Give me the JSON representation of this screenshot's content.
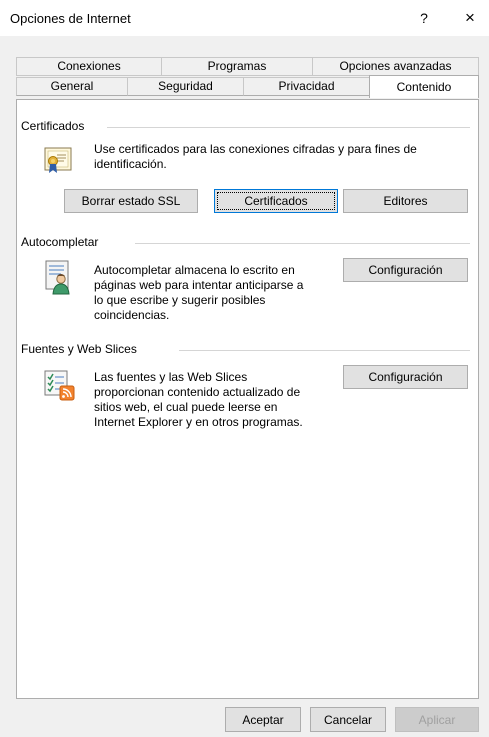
{
  "window": {
    "title": "Opciones de Internet",
    "help": "?",
    "close": "×"
  },
  "tabs_row1": [
    "Conexiones",
    "Programas",
    "Opciones avanzadas"
  ],
  "tabs_row2": [
    "General",
    "Seguridad",
    "Privacidad",
    "Contenido"
  ],
  "active_tab": "Contenido",
  "certificates": {
    "header": "Certificados",
    "line1": "Use certificados para las conexiones cifradas y para fines de",
    "line2": "identificación.",
    "btn_ssl": "Borrar estado SSL",
    "btn_certs": "Certificados",
    "btn_publishers": "Editores"
  },
  "autocomplete": {
    "header": "Autocompletar",
    "lines": [
      "Autocompletar almacena lo escrito en",
      "páginas web para intentar anticiparse a",
      "lo que escribe y sugerir posibles",
      "coincidencias."
    ],
    "btn": "Configuración"
  },
  "feeds": {
    "header": "Fuentes y Web Slices",
    "lines": [
      "Las fuentes y las Web Slices",
      "proporcionan contenido actualizado de",
      "sitios web, el cual puede leerse en",
      "Internet Explorer y en otros programas."
    ],
    "btn": "Configuración"
  },
  "footer": {
    "ok": "Aceptar",
    "cancel": "Cancelar",
    "apply": "Aplicar"
  }
}
